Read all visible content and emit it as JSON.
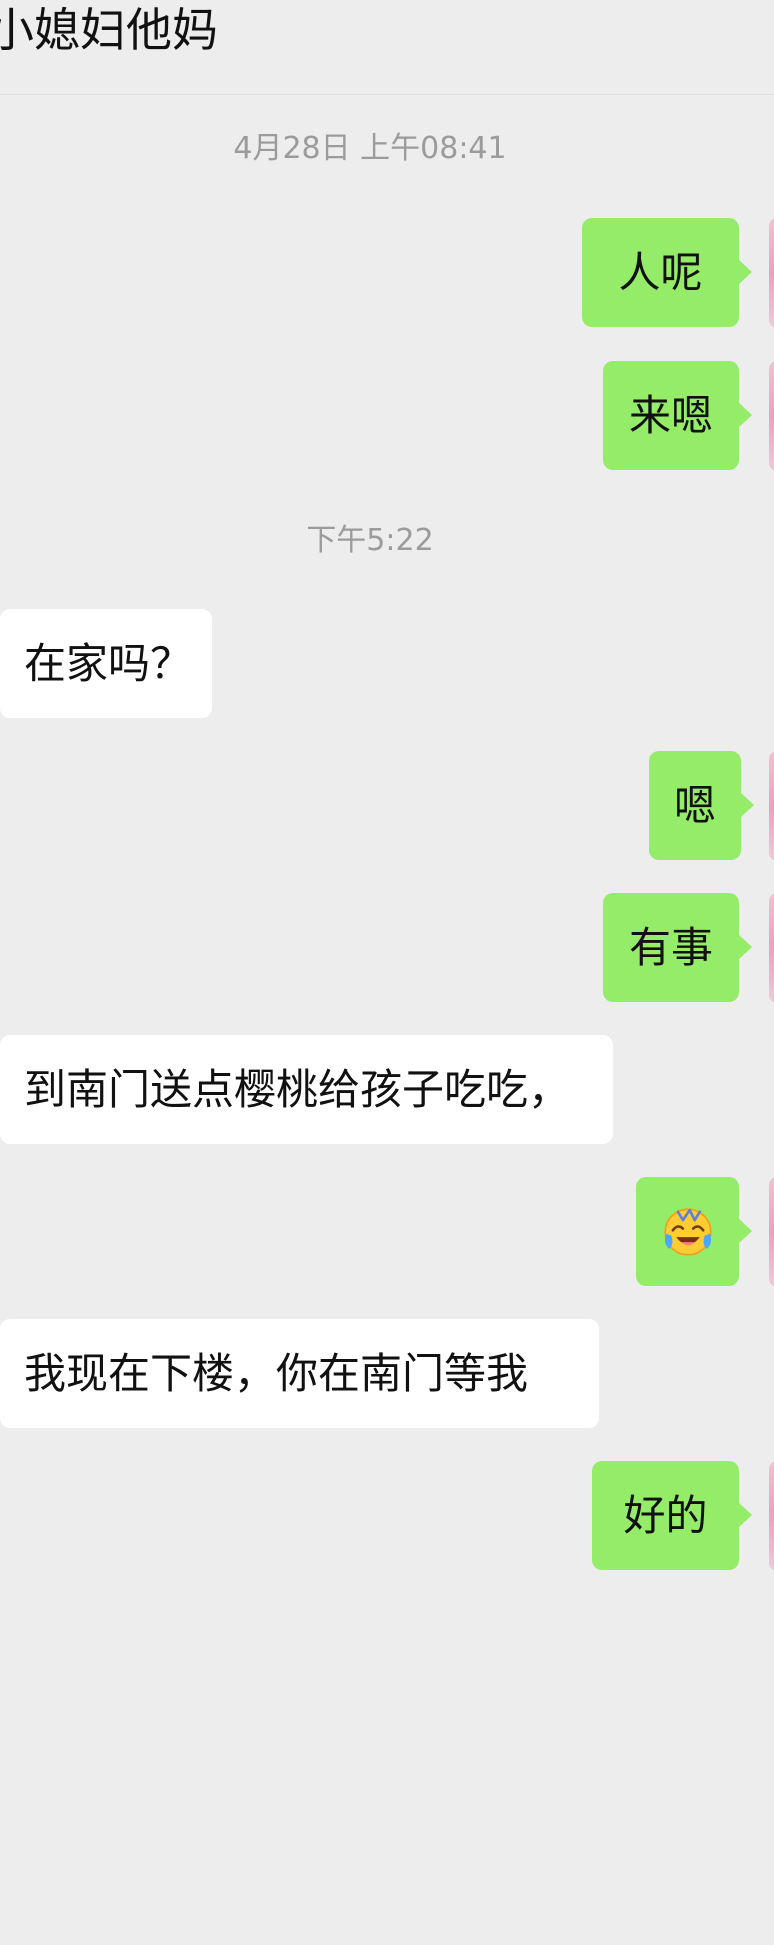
{
  "header": {
    "title": "小媳妇他妈"
  },
  "timestamps": [
    "4月28日 上午08:41",
    "下午5:22"
  ],
  "messages": [
    {
      "direction": "out",
      "text": "人呢"
    },
    {
      "direction": "out",
      "text": "来嗯"
    },
    {
      "direction": "in",
      "text": "在家吗？"
    },
    {
      "direction": "out",
      "text": "嗯"
    },
    {
      "direction": "out",
      "text": "有事"
    },
    {
      "direction": "in",
      "text": "到南门送点樱桃给孩子吃吃，"
    },
    {
      "direction": "out",
      "emoji": "face-with-tears-of-joy-icon"
    },
    {
      "direction": "in",
      "text": "我现在下楼，你在南门等我"
    },
    {
      "direction": "out",
      "text": "好的"
    }
  ],
  "colors": {
    "background": "#ededed",
    "outgoing_bubble": "#95ec69",
    "incoming_bubble": "#ffffff",
    "timestamp_text": "#9b9b9b"
  }
}
